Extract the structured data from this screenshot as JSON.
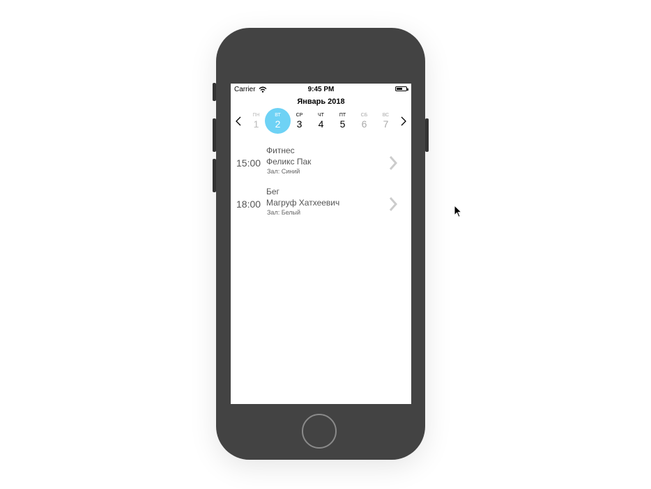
{
  "status_bar": {
    "carrier": "Carrier",
    "time": "9:45 PM",
    "battery_level": 0.6
  },
  "calendar": {
    "month_title": "Январь 2018",
    "selected_index": 1,
    "days": [
      {
        "name": "ПН",
        "date": "1"
      },
      {
        "name": "ВТ",
        "date": "2"
      },
      {
        "name": "СР",
        "date": "3"
      },
      {
        "name": "ЧТ",
        "date": "4"
      },
      {
        "name": "ПТ",
        "date": "5"
      },
      {
        "name": "СБ",
        "date": "6"
      },
      {
        "name": "ВС",
        "date": "7"
      }
    ]
  },
  "events": [
    {
      "time": "15:00",
      "title": "Фитнес",
      "trainer": "Феликс Пак",
      "hall": "Зал: Синий"
    },
    {
      "time": "18:00",
      "title": "Бег",
      "trainer": "Магруф Хатхеевич",
      "hall": "Зал: Белый"
    }
  ],
  "colors": {
    "accent": "#6ed2f5",
    "phone_body": "#434343"
  }
}
